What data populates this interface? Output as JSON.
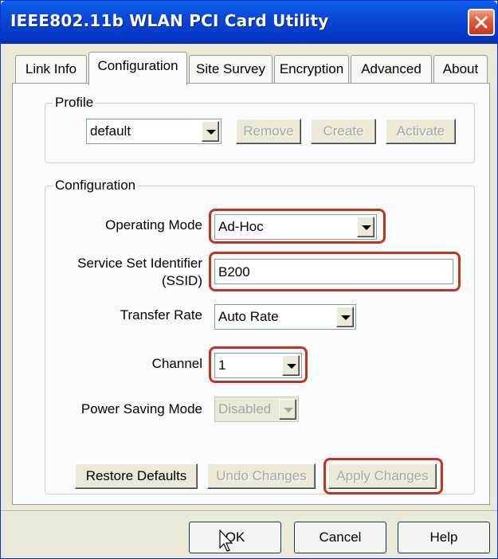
{
  "window": {
    "title": "IEEE802.11b WLAN PCI Card Utility"
  },
  "tabs": [
    {
      "label": "Link Info"
    },
    {
      "label": "Configuration"
    },
    {
      "label": "Site Survey"
    },
    {
      "label": "Encryption"
    },
    {
      "label": "Advanced"
    },
    {
      "label": "About"
    }
  ],
  "profile": {
    "group_label": "Profile",
    "selected": "default",
    "remove": "Remove",
    "create": "Create",
    "activate": "Activate"
  },
  "configuration": {
    "group_label": "Configuration",
    "operating_mode_label": "Operating Mode",
    "operating_mode": "Ad-Hoc",
    "ssid_label_1": "Service Set Identifier",
    "ssid_label_2": "(SSID)",
    "ssid": "B200",
    "transfer_rate_label": "Transfer Rate",
    "transfer_rate": "Auto Rate",
    "channel_label": "Channel",
    "channel": "1",
    "power_saving_label": "Power Saving Mode",
    "power_saving": "Disabled",
    "restore_defaults": "Restore Defaults",
    "undo_changes": "Undo Changes",
    "apply_changes": "Apply Changes"
  },
  "footer": {
    "ok": "OK",
    "cancel": "Cancel",
    "help": "Help"
  },
  "colors": {
    "highlight": "#c4341b",
    "titlebar": "#0a48d6",
    "face": "#ece9d8"
  }
}
